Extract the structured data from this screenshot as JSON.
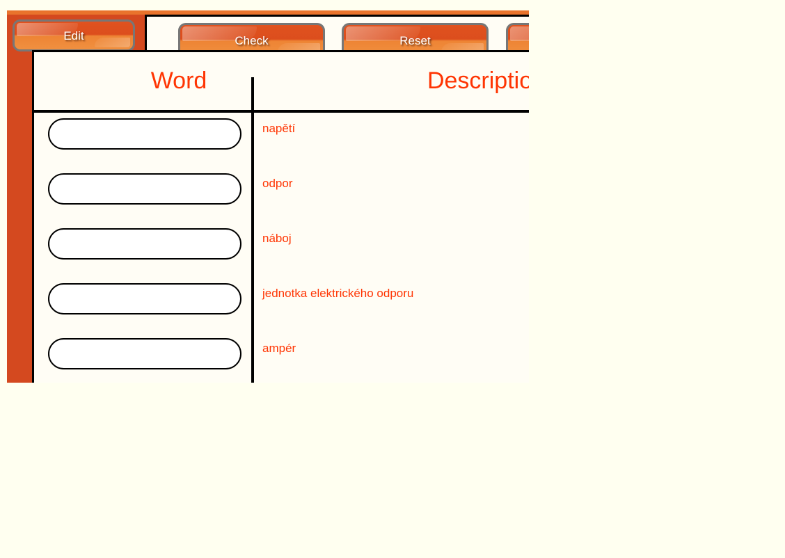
{
  "theme": {
    "accent_orange": "#d4491f",
    "accent_orange_light": "#e9732c",
    "text_red": "#ff3503",
    "page_background": "#fffff0",
    "content_background": "#fffdf5",
    "rule_color": "#000000",
    "button_border": "#777777",
    "button_text": "#ffffff"
  },
  "toolbar": {
    "tab_label": "Edit",
    "buttons": [
      {
        "name": "check",
        "label": "Check"
      },
      {
        "name": "reset",
        "label": "Reset"
      },
      {
        "name": "next",
        "label": ""
      }
    ]
  },
  "table": {
    "headers": {
      "word": "Word",
      "description": "Description"
    },
    "rows": [
      {
        "word_value": "",
        "word_placeholder": "",
        "description": "napětí"
      },
      {
        "word_value": "",
        "word_placeholder": "",
        "description": "odpor"
      },
      {
        "word_value": "",
        "word_placeholder": "",
        "description": "náboj"
      },
      {
        "word_value": "",
        "word_placeholder": "",
        "description": "jednotka elektrického odporu"
      },
      {
        "word_value": "",
        "word_placeholder": "",
        "description": "ampér"
      }
    ]
  }
}
